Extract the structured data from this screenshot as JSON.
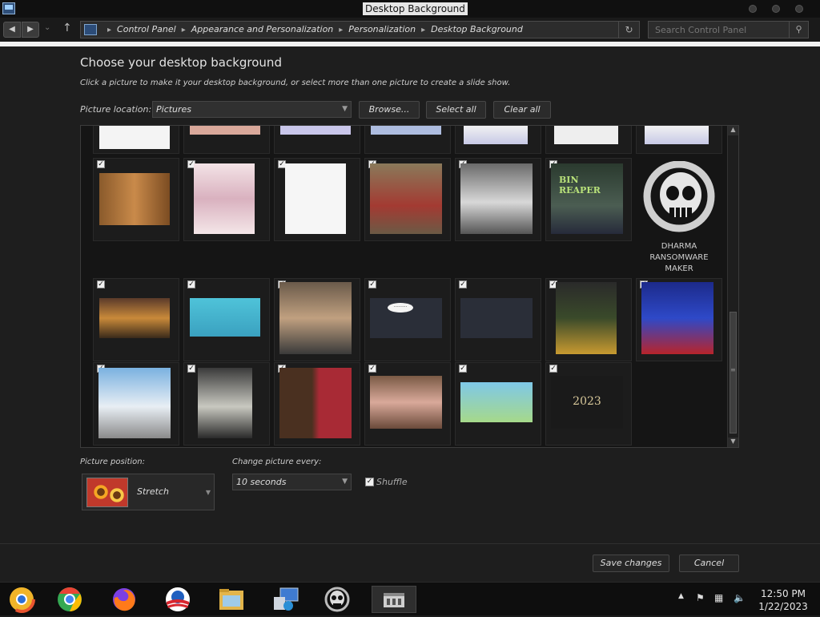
{
  "window": {
    "title": "Desktop Background"
  },
  "address": {
    "crumbs": [
      "Control Panel",
      "Appearance and Personalization",
      "Personalization",
      "Desktop Background"
    ]
  },
  "search": {
    "placeholder": "Search Control Panel"
  },
  "page": {
    "heading": "Choose your desktop background",
    "subtext": "Click a picture to make it your desktop background, or select more than one picture to create a slide show."
  },
  "location": {
    "label": "Picture location:",
    "value": "Pictures",
    "browse": "Browse...",
    "select_all": "Select all",
    "clear_all": "Clear all"
  },
  "gallery": {
    "skull_caption": [
      "DHARMA",
      "RANSOMWARE",
      "MAKER"
    ],
    "year_text": "2023",
    "speech_text": "·········",
    "album_text": "BIN REAPER"
  },
  "position": {
    "label": "Picture position:",
    "value": "Stretch"
  },
  "change": {
    "label": "Change picture every:",
    "value": "10 seconds"
  },
  "shuffle": {
    "label": "Shuffle",
    "checked": true
  },
  "actions": {
    "save": "Save changes",
    "cancel": "Cancel"
  },
  "taskbar": {
    "items": [
      "chrome-canary",
      "chrome",
      "firefox",
      "obama-logo",
      "file-explorer",
      "control-panel",
      "skull-app",
      "active-window"
    ],
    "time": "12:50 PM",
    "date": "1/22/2023"
  }
}
